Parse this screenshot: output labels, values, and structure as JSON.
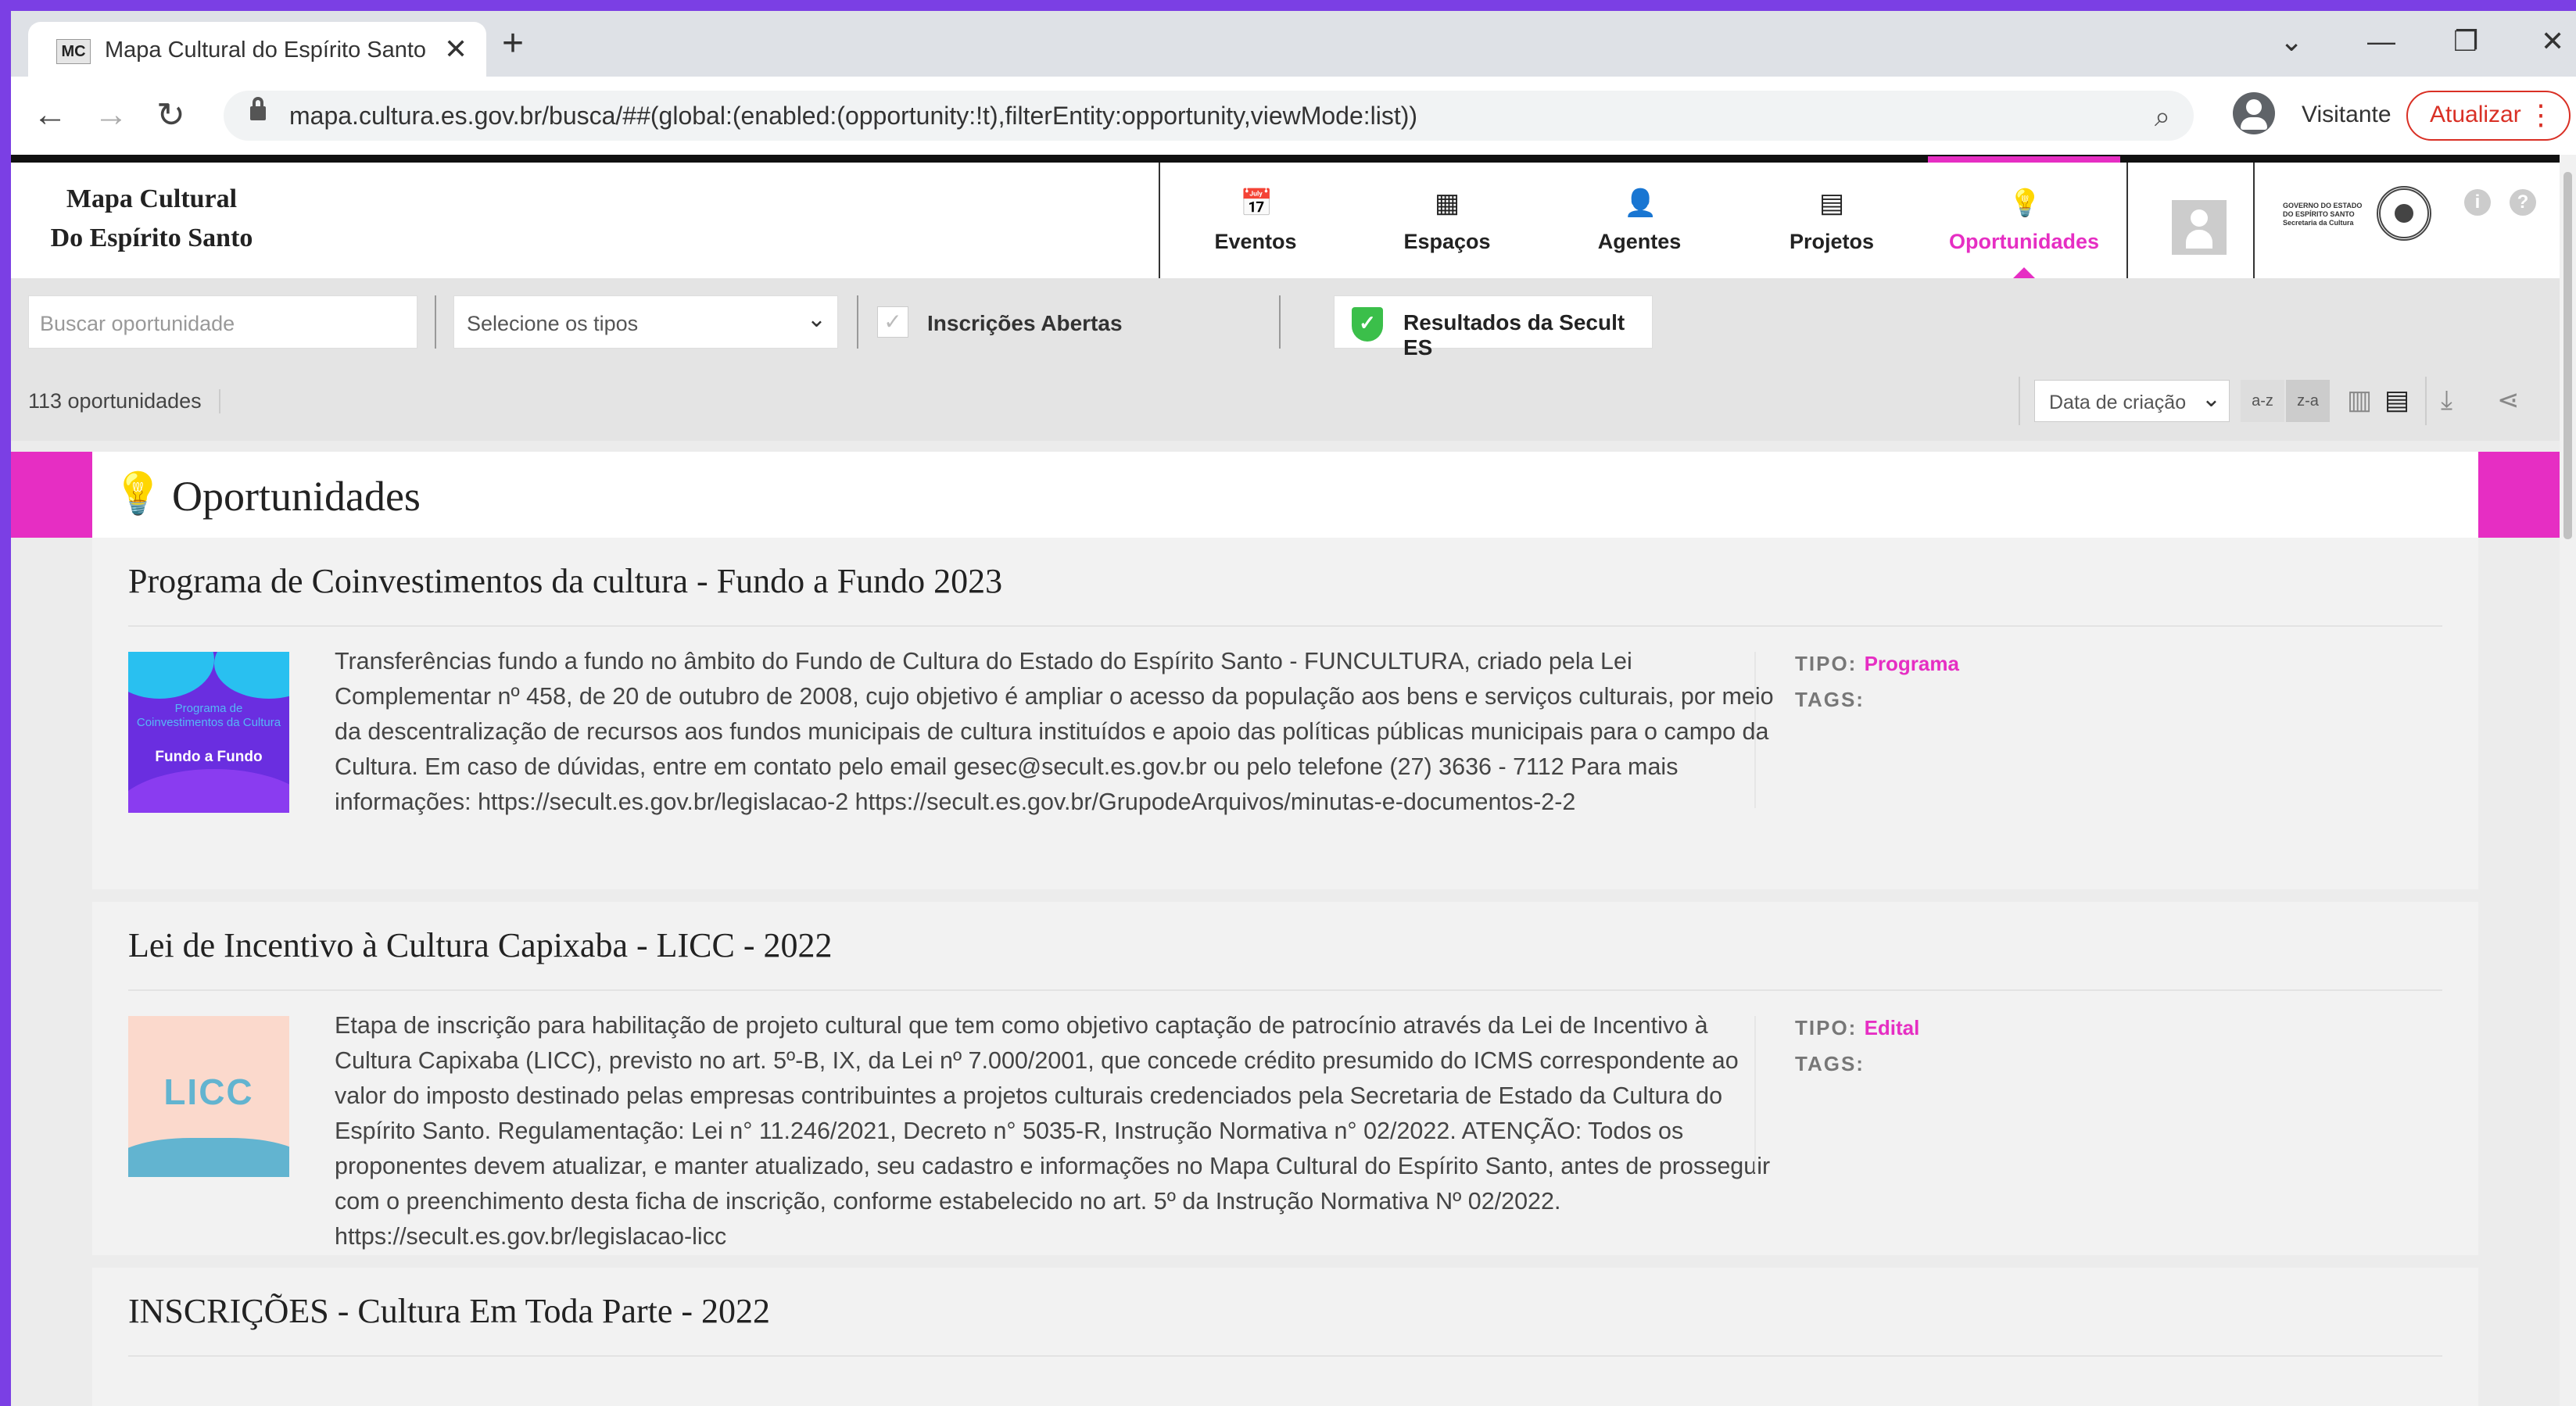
{
  "browser": {
    "tab_title": "Mapa Cultural do Espírito Santo",
    "tab_favicon": "MC",
    "url": "mapa.cultura.es.gov.br/busca/##(global:(enabled:(opportunity:!t),filterEntity:opportunity,viewMode:list))",
    "profile_label": "Visitante",
    "update_label": "Atualizar"
  },
  "site": {
    "brand_line1": "Mapa Cultural",
    "brand_line2": "Do Espírito Santo",
    "nav": [
      {
        "label": "Eventos",
        "icon": "calendar-icon"
      },
      {
        "label": "Espaços",
        "icon": "building-icon"
      },
      {
        "label": "Agentes",
        "icon": "person-icon"
      },
      {
        "label": "Projetos",
        "icon": "document-icon"
      },
      {
        "label": "Oportunidades",
        "icon": "lightbulb-icon",
        "active": true
      }
    ],
    "gov_logo_text": "GOVERNO DO ESTADO DO ESPÍRITO SANTO Secretaria da Cultura",
    "accent_color": "#e62ec3"
  },
  "filters": {
    "search_placeholder": "Buscar oportunidade",
    "types_select": "Selecione os tipos",
    "open_label": "Inscrições Abertas",
    "results_label": "Resultados da Secult ES"
  },
  "list": {
    "count": "113 oportunidades",
    "sort_value": "Data de criação",
    "sort_az": "a-z",
    "sort_za": "z-a",
    "section_title": "Oportunidades",
    "type_key": "TIPO:",
    "tags_key": "TAGS:",
    "items": [
      {
        "title": "Programa de Coinvestimentos da cultura - Fundo a Fundo 2023",
        "desc": "Transferências fundo a fundo no âmbito do Fundo de Cultura do Estado do Espírito Santo - FUNCULTURA, criado pela Lei Complementar nº 458, de 20 de outubro de 2008, cujo objetivo é ampliar o acesso da população aos bens e serviços culturais, por meio da descentralização de recursos aos fundos municipais de cultura instituídos e apoio das políticas públicas municipais para o campo da Cultura. Em caso de dúvidas, entre em contato pelo email gesec@secult.es.gov.br ou pelo telefone (27) 3636 - 7112 Para mais informações: https://secult.es.gov.br/legislacao-2 https://secult.es.gov.br/GrupodeArquivos/minutas-e-documentos-2-2",
        "type": "Programa",
        "thumb_line1": "Programa de Coinvestimentos da Cultura",
        "thumb_line2": "Fundo a Fundo"
      },
      {
        "title": "Lei de Incentivo à Cultura Capixaba - LICC - 2022",
        "desc": "Etapa de inscrição para habilitação de projeto cultural que tem como objetivo captação de patrocínio através da Lei de Incentivo à Cultura Capixaba (LICC), previsto no art. 5º-B, IX, da Lei nº 7.000/2001, que concede crédito presumido do ICMS correspondente ao valor do imposto destinado pelas empresas contribuintes a projetos culturais credenciados pela Secretaria de Estado da Cultura do Espírito Santo. Regulamentação: Lei n° 11.246/2021, Decreto n° 5035-R, Instrução Normativa n° 02/2022. ATENÇÃO: Todos os proponentes devem atualizar, e manter atualizado, seu cadastro e informações no Mapa Cultural do Espírito Santo, antes de prosseguir com o preenchimento desta ficha de inscrição, conforme estabelecido no art. 5º da Instrução Normativa Nº 02/2022. https://secult.es.gov.br/legislacao-licc",
        "type": "Edital",
        "thumb_label": "LICC"
      },
      {
        "title": "INSCRIÇÕES - Cultura Em Toda Parte - 2022"
      }
    ]
  }
}
